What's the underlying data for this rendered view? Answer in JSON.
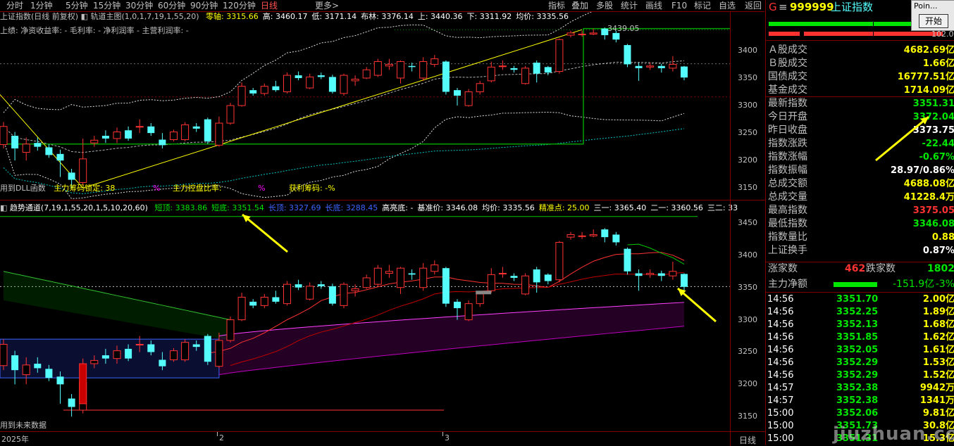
{
  "toolbar": {
    "items": [
      "分时",
      "1分钟",
      "5分钟",
      "15分钟",
      "30分钟",
      "60分钟",
      "90分钟",
      "120分钟",
      "日线",
      "更多"
    ],
    "active_index": 8,
    "more_arrow": ">",
    "right_items": [
      "指标",
      "叠加",
      "多股",
      "统计",
      "画线",
      "F10",
      "标记",
      "自选",
      "返回"
    ]
  },
  "main_chart": {
    "title": "上证指数(日线 前复权)",
    "indicator_name": "轨道主图(1,0,1,7,19,1,55,20)",
    "values_line": [
      {
        "label": "零轴:",
        "value": "3315.66"
      },
      {
        "label": "高:",
        "value": "3460.17"
      },
      {
        "label": "低:",
        "value": "3171.14"
      },
      {
        "label": "布林:",
        "value": "3376.14"
      },
      {
        "label": "上:",
        "value": "3440.36"
      },
      {
        "label": "下:",
        "value": "3311.92"
      },
      {
        "label": "均价:",
        "value": "3335.56"
      }
    ],
    "subtitle": "上绩: 净资收益率: - 毛利率: - 净利润率 - 主营利润率: -",
    "bottom_labels": [
      "用到DLL函数",
      "主力筹码锁定: 38",
      "%",
      "主力控盘比率:",
      "%",
      "获利筹码: -%"
    ],
    "peak_label": "3439.05",
    "y_axis": [
      "3400",
      "3350",
      "3300",
      "3250",
      "3200",
      "3150"
    ],
    "y_range": [
      3135,
      3460
    ]
  },
  "sub_chart": {
    "indicator_name": "趋势通道(7,19,1,55,20,1,5,10,20,60)",
    "values_line": [
      {
        "label": "短顶:",
        "value": "3383.86"
      },
      {
        "label": "短底:",
        "value": "3351.54"
      },
      {
        "label": "长顶:",
        "value": "3327.69"
      },
      {
        "label": "长底:",
        "value": "3288.45"
      },
      {
        "label": "高亮底:",
        "value": "-"
      },
      {
        "label": "基准价:",
        "value": "3346.08"
      },
      {
        "label": "均价:",
        "value": "3335.56"
      },
      {
        "label": "精准点:",
        "value": "25.00"
      },
      {
        "label": "三一:",
        "value": "3365.40"
      },
      {
        "label": "二一:",
        "value": "3360.56"
      },
      {
        "label": "三二:",
        "value": "33"
      }
    ],
    "bottom_label": "用到未来数据",
    "y_axis": [
      "3450",
      "3400",
      "3350",
      "3300",
      "3250",
      "3200",
      "3150"
    ],
    "y_range": [
      3135,
      3475
    ]
  },
  "x_axis": {
    "labels": [
      "2025年",
      "2",
      "3"
    ],
    "period_label": "日线"
  },
  "candles": [
    {
      "o": 3229,
      "c": 3262,
      "h": 3270,
      "l": 3222
    },
    {
      "o": 3245,
      "c": 3222,
      "h": 3252,
      "l": 3200
    },
    {
      "o": 3215,
      "c": 3230,
      "h": 3242,
      "l": 3200
    },
    {
      "o": 3232,
      "c": 3225,
      "h": 3242,
      "l": 3218
    },
    {
      "o": 3224,
      "c": 3210,
      "h": 3230,
      "l": 3205
    },
    {
      "o": 3212,
      "c": 3200,
      "h": 3220,
      "l": 3170
    },
    {
      "o": 3178,
      "c": 3165,
      "h": 3185,
      "l": 3150
    },
    {
      "o": 3160,
      "c": 3203,
      "h": 3240,
      "l": 3155
    },
    {
      "o": 3232,
      "c": 3237,
      "h": 3245,
      "l": 3225
    },
    {
      "o": 3245,
      "c": 3240,
      "h": 3255,
      "l": 3232
    },
    {
      "o": 3240,
      "c": 3252,
      "h": 3260,
      "l": 3232
    },
    {
      "o": 3255,
      "c": 3240,
      "h": 3262,
      "l": 3236
    },
    {
      "o": 3262,
      "c": 3262,
      "h": 3275,
      "l": 3250
    },
    {
      "o": 3262,
      "c": 3250,
      "h": 3268,
      "l": 3245
    },
    {
      "o": 3238,
      "c": 3228,
      "h": 3250,
      "l": 3222
    },
    {
      "o": 3238,
      "c": 3252,
      "h": 3256,
      "l": 3235
    },
    {
      "o": 3238,
      "c": 3265,
      "h": 3270,
      "l": 3235
    },
    {
      "o": 3262,
      "c": 3258,
      "h": 3268,
      "l": 3252
    },
    {
      "o": 3275,
      "c": 3235,
      "h": 3278,
      "l": 3230
    },
    {
      "o": 3228,
      "c": 3268,
      "h": 3280,
      "l": 3225
    },
    {
      "o": 3268,
      "c": 3300,
      "h": 3305,
      "l": 3265
    },
    {
      "o": 3300,
      "c": 3335,
      "h": 3342,
      "l": 3298
    },
    {
      "o": 3328,
      "c": 3322,
      "h": 3332,
      "l": 3318
    },
    {
      "o": 3322,
      "c": 3335,
      "h": 3340,
      "l": 3318
    },
    {
      "o": 3335,
      "c": 3328,
      "h": 3345,
      "l": 3325
    },
    {
      "o": 3325,
      "c": 3355,
      "h": 3360,
      "l": 3322
    },
    {
      "o": 3355,
      "c": 3350,
      "h": 3362,
      "l": 3346
    },
    {
      "o": 3332,
      "c": 3352,
      "h": 3358,
      "l": 3330
    },
    {
      "o": 3355,
      "c": 3352,
      "h": 3360,
      "l": 3348
    },
    {
      "o": 3352,
      "c": 3325,
      "h": 3356,
      "l": 3322
    },
    {
      "o": 3322,
      "c": 3355,
      "h": 3358,
      "l": 3318
    },
    {
      "o": 3345,
      "c": 3348,
      "h": 3355,
      "l": 3336
    },
    {
      "o": 3350,
      "c": 3365,
      "h": 3370,
      "l": 3348
    },
    {
      "o": 3355,
      "c": 3380,
      "h": 3385,
      "l": 3352
    },
    {
      "o": 3372,
      "c": 3375,
      "h": 3385,
      "l": 3365
    },
    {
      "o": 3350,
      "c": 3380,
      "h": 3382,
      "l": 3340
    },
    {
      "o": 3372,
      "c": 3370,
      "h": 3378,
      "l": 3362
    },
    {
      "o": 3350,
      "c": 3380,
      "h": 3388,
      "l": 3345
    },
    {
      "o": 3375,
      "c": 3385,
      "h": 3392,
      "l": 3370
    },
    {
      "o": 3380,
      "c": 3325,
      "h": 3382,
      "l": 3320
    },
    {
      "o": 3328,
      "c": 3318,
      "h": 3332,
      "l": 3300
    },
    {
      "o": 3300,
      "c": 3325,
      "h": 3330,
      "l": 3298
    },
    {
      "o": 3325,
      "c": 3340,
      "h": 3345,
      "l": 3320
    },
    {
      "o": 3345,
      "c": 3370,
      "h": 3380,
      "l": 3342
    },
    {
      "o": 3372,
      "c": 3372,
      "h": 3382,
      "l": 3365
    },
    {
      "o": 3368,
      "c": 3365,
      "h": 3372,
      "l": 3360
    },
    {
      "o": 3340,
      "c": 3368,
      "h": 3372,
      "l": 3338
    },
    {
      "o": 3378,
      "c": 3358,
      "h": 3382,
      "l": 3342
    },
    {
      "o": 3370,
      "c": 3360,
      "h": 3372,
      "l": 3355
    },
    {
      "o": 3362,
      "c": 3420,
      "h": 3422,
      "l": 3358
    },
    {
      "o": 3428,
      "c": 3432,
      "h": 3436,
      "l": 3424
    },
    {
      "o": 3430,
      "c": 3430,
      "h": 3436,
      "l": 3425
    },
    {
      "o": 3430,
      "c": 3432,
      "h": 3440,
      "l": 3428
    },
    {
      "o": 3440,
      "c": 3428,
      "h": 3442,
      "l": 3420
    },
    {
      "o": 3432,
      "c": 3420,
      "h": 3436,
      "l": 3415
    },
    {
      "o": 3410,
      "c": 3375,
      "h": 3412,
      "l": 3370
    },
    {
      "o": 3372,
      "c": 3368,
      "h": 3378,
      "l": 3345
    },
    {
      "o": 3370,
      "c": 3372,
      "h": 3378,
      "l": 3365
    },
    {
      "o": 3372,
      "c": 3368,
      "h": 3376,
      "l": 3360
    },
    {
      "o": 3368,
      "c": 3375,
      "h": 3390,
      "l": 3362
    },
    {
      "o": 3371,
      "c": 3351,
      "h": 3372,
      "l": 3346
    }
  ],
  "panel": {
    "header": {
      "code": "999999",
      "name": "上证指数",
      "prefix": "G",
      "menu": "≡"
    },
    "rows": [
      {
        "label": "Ａ股成交",
        "value": "4682.69亿",
        "color": "yellow"
      },
      {
        "label": "Ｂ股成交",
        "value": "1.66亿",
        "color": "yellow"
      },
      {
        "label": "国债成交",
        "value": "16777.51亿",
        "color": "yellow"
      },
      {
        "label": "基金成交",
        "value": "1714.09亿",
        "color": "yellow"
      },
      {
        "label": "最新指数",
        "value": "3351.31",
        "color": "green"
      },
      {
        "label": "今日开盘",
        "value": "3372.04",
        "color": "green"
      },
      {
        "label": "昨日收盘",
        "value": "3373.75",
        "color": "white"
      },
      {
        "label": "指数涨跌",
        "value": "-22.44",
        "color": "green"
      },
      {
        "label": "指数涨幅",
        "value": "-0.67%",
        "color": "green"
      },
      {
        "label": "指数振幅",
        "value": "28.97/0.86%",
        "color": "white"
      },
      {
        "label": "总成交额",
        "value": "4688.08亿",
        "color": "yellow"
      },
      {
        "label": "总成交量",
        "value": "41228.4万",
        "color": "yellow"
      },
      {
        "label": "最高指数",
        "value": "3375.05",
        "color": "red"
      },
      {
        "label": "最低指数",
        "value": "3346.08",
        "color": "green"
      },
      {
        "label": "指数量比",
        "value": "0.88",
        "color": "yellow"
      },
      {
        "label": "上证换手",
        "value": "0.87%",
        "color": "white"
      }
    ],
    "updown": {
      "up_label": "涨家数",
      "up_value": "462",
      "down_label": "跌家数",
      "down_value": "1802"
    },
    "netflow": {
      "label": "主力净额",
      "value": "-151.9亿",
      "pct": "-3%"
    },
    "ticks": [
      {
        "time": "14:56",
        "price": "3351.70",
        "amount": "2.00亿"
      },
      {
        "time": "14:56",
        "price": "3352.25",
        "amount": "1.89亿"
      },
      {
        "time": "14:56",
        "price": "3352.13",
        "amount": "1.68亿"
      },
      {
        "time": "14:56",
        "price": "3351.85",
        "amount": "1.62亿"
      },
      {
        "time": "14:56",
        "price": "3352.05",
        "amount": "1.61亿"
      },
      {
        "time": "14:56",
        "price": "3352.29",
        "amount": "1.53亿"
      },
      {
        "time": "14:56",
        "price": "3352.29",
        "amount": "1.52亿"
      },
      {
        "time": "14:57",
        "price": "3352.38",
        "amount": "9942万"
      },
      {
        "time": "14:57",
        "price": "3352.38",
        "amount": "1341万"
      },
      {
        "time": "15:00",
        "price": "3352.06",
        "amount": "9.81亿"
      },
      {
        "time": "15:00",
        "price": "3351.73",
        "amount": "30.8亿"
      },
      {
        "time": "15:00",
        "price": "3351.31",
        "amount": "15.3亿"
      }
    ]
  },
  "popup": {
    "title": "Poin...",
    "button": "开始"
  },
  "watermark": "jiuzhuan.com",
  "colors": {
    "up": "#ff3232",
    "down": "#54fcfc",
    "grid": "#800000",
    "bg": "#000000",
    "yellow": "#ffff00",
    "green": "#00e600"
  }
}
